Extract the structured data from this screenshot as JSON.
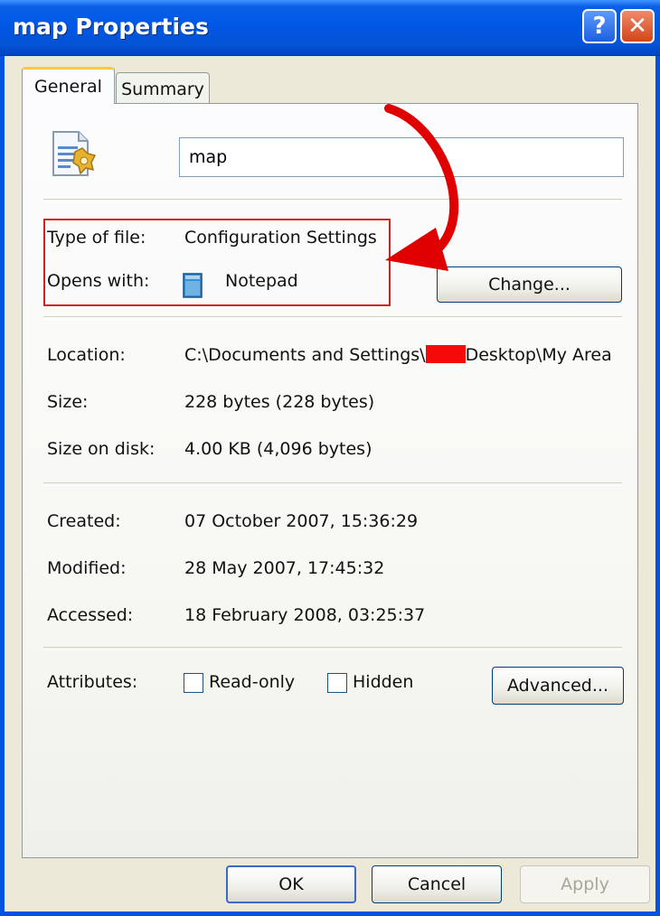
{
  "window": {
    "title": "map Properties",
    "help_glyph": "?",
    "close_glyph": "✕"
  },
  "tabs": [
    {
      "label": "General",
      "active": true
    },
    {
      "label": "Summary",
      "active": false
    }
  ],
  "general": {
    "file_name": "map",
    "type_of_file_label": "Type of file:",
    "type_of_file_value": "Configuration Settings",
    "opens_with_label": "Opens with:",
    "opens_with_value": "Notepad",
    "change_button": "Change...",
    "location_label": "Location:",
    "location_prefix": "C:\\Documents and Settings\\",
    "location_suffix": "Desktop\\My Area",
    "size_label": "Size:",
    "size_value": "228 bytes (228 bytes)",
    "size_on_disk_label": "Size on disk:",
    "size_on_disk_value": "4.00 KB (4,096 bytes)",
    "created_label": "Created:",
    "created_value": "07 October 2007, 15:36:29",
    "modified_label": "Modified:",
    "modified_value": "28 May 2007, 17:45:32",
    "accessed_label": "Accessed:",
    "accessed_value": "18 February 2008, 03:25:37",
    "attributes_label": "Attributes:",
    "readonly_label": "Read-only",
    "readonly_checked": false,
    "hidden_label": "Hidden",
    "hidden_checked": false,
    "advanced_button": "Advanced..."
  },
  "footer": {
    "ok_button": "OK",
    "cancel_button": "Cancel",
    "apply_button": "Apply"
  },
  "annotation": {
    "highlight_color": "#D02020",
    "arrow_color": "#E00000",
    "redaction_color": "#F50A0A"
  }
}
